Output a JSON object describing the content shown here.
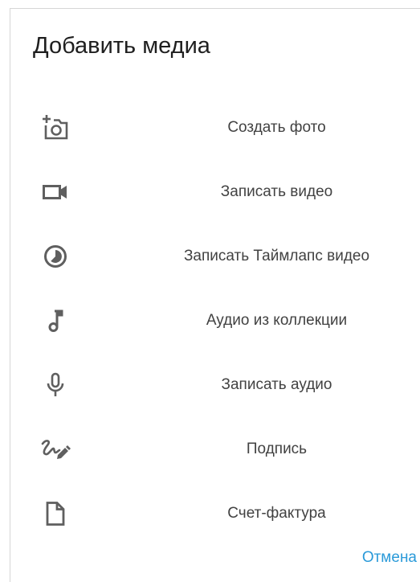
{
  "dialog": {
    "title": "Добавить медиа",
    "items": [
      {
        "label": "Создать фото",
        "icon": "add-photo-icon"
      },
      {
        "label": "Записать видео",
        "icon": "videocam-icon"
      },
      {
        "label": "Записать Таймлапс видео",
        "icon": "timelapse-icon"
      },
      {
        "label": "Аудио из коллекции",
        "icon": "music-note-icon"
      },
      {
        "label": "Записать аудио",
        "icon": "microphone-icon"
      },
      {
        "label": "Подпись",
        "icon": "signature-icon"
      },
      {
        "label": "Счет-фактура",
        "icon": "document-icon"
      }
    ],
    "cancel_label": "Отмена"
  },
  "colors": {
    "icon": "#5f5f5f",
    "text": "#424242",
    "title": "#1f1f1f",
    "accent": "#2a9ad9"
  }
}
